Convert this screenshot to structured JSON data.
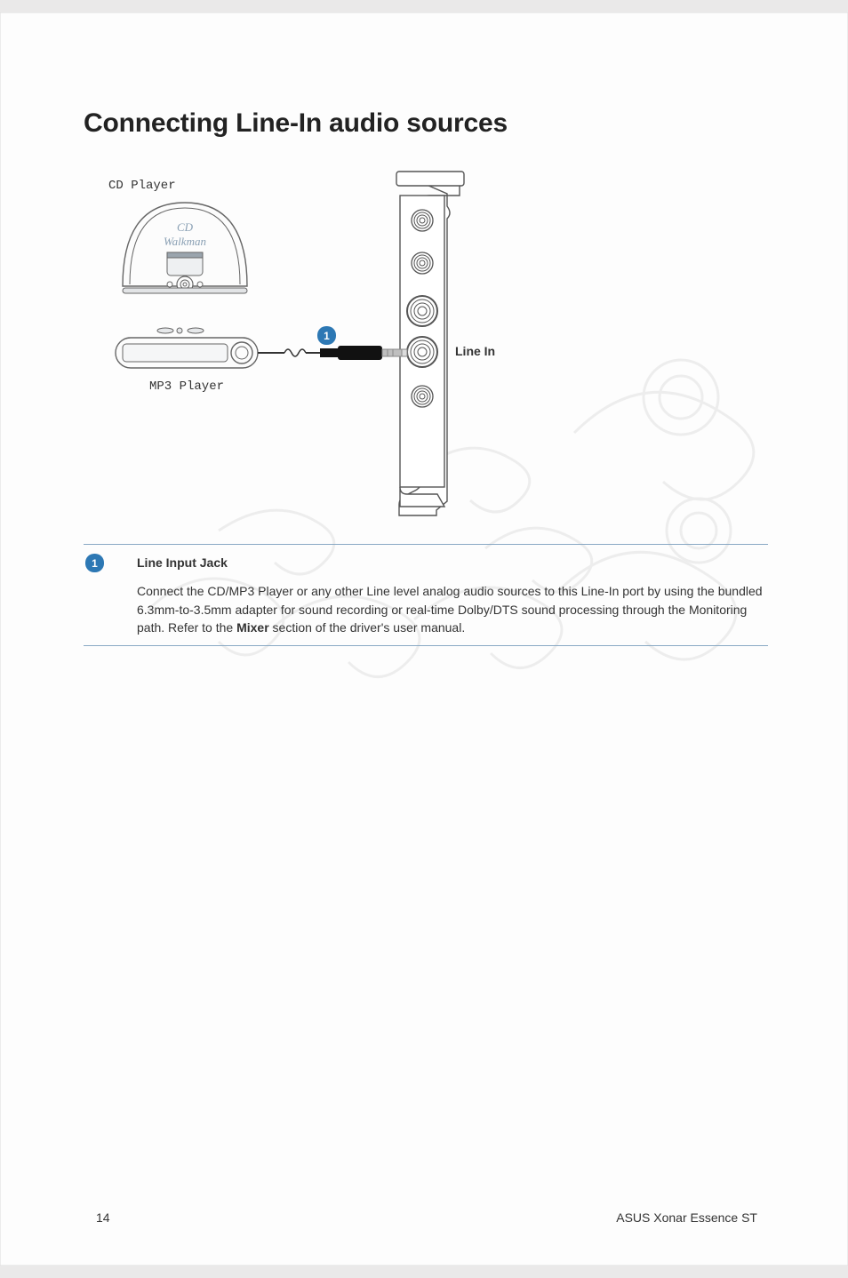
{
  "header": {
    "title": "Connecting Line-In audio sources"
  },
  "diagram": {
    "cd_label": "CD Player",
    "cd_screen1": "CD",
    "cd_screen2": "Walkman",
    "mp3_label": "MP3 Player",
    "port_label": "Line In",
    "callout1": "1"
  },
  "table": {
    "rows": [
      {
        "num": "1",
        "title": "Line Input Jack",
        "body_parts": [
          "Connect the CD/MP3 Player or any other Line level analog audio sources to this Line-In port by using the bundled 6.3mm-to-3.5mm adapter for sound recording or real-time Dolby/DTS sound processing through the Monitoring path. Refer to the ",
          "Mixer",
          " section of the driver's user manual."
        ]
      }
    ]
  },
  "footer": {
    "page": "14",
    "product": "ASUS Xonar Essence ST"
  }
}
